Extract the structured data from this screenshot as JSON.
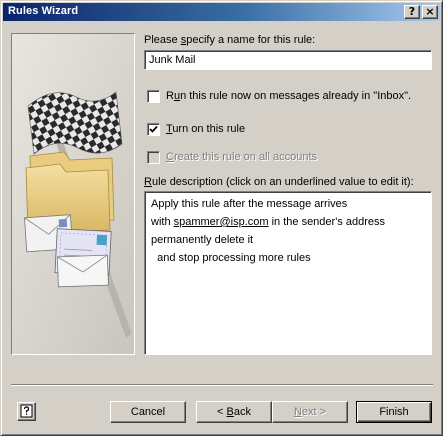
{
  "window": {
    "title": "Rules Wizard",
    "help_button": "?",
    "close_button": "×"
  },
  "name_section": {
    "label_before": "Please ",
    "label_accel": "s",
    "label_after": "pecify a name for this rule:",
    "value": "Junk Mail"
  },
  "options": {
    "run_now": {
      "accel": "u",
      "label_before": "R",
      "label_after": "n this rule now on messages already in \"Inbox\".",
      "checked": false,
      "enabled": true
    },
    "turn_on": {
      "accel": "T",
      "label_after": "urn on this rule",
      "checked": true,
      "enabled": true
    },
    "all_accounts": {
      "accel": "C",
      "label_after": "reate this rule on all accounts",
      "checked": false,
      "enabled": false
    }
  },
  "description": {
    "label_accel": "R",
    "label_after": "ule description (click on an underlined value to edit it):",
    "lines": [
      {
        "text": "Apply this rule after the message arrives"
      },
      {
        "prefix": "with ",
        "link": "spammer@isp.com",
        "suffix": " in the sender's address"
      },
      {
        "text": "permanently delete it"
      },
      {
        "text": "  and stop processing more rules"
      }
    ]
  },
  "buttons": {
    "cancel": "Cancel",
    "back_prefix": "< ",
    "back_accel": "B",
    "back_suffix": "ack",
    "next_prefix": "",
    "next_accel": "N",
    "next_suffix": "ext >",
    "finish": "Finish"
  },
  "icons": {
    "help": "help-question-icon",
    "illustration": "checkered-flag-folder-envelope-illustration"
  }
}
